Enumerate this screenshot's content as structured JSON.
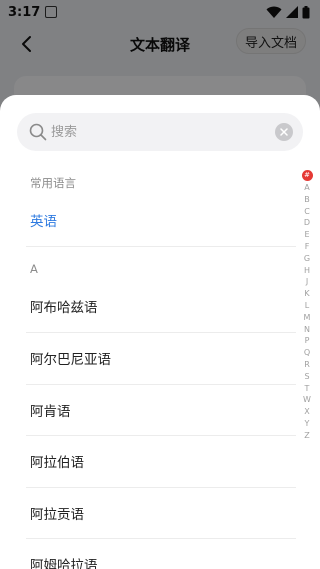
{
  "status_bar": {
    "time": "3:17"
  },
  "header": {
    "title": "文本翻译",
    "import_label": "导入文档"
  },
  "search": {
    "placeholder": "搜索"
  },
  "common": {
    "section_label": "常用语言",
    "items": [
      "英语"
    ]
  },
  "section_a": {
    "label": "A",
    "items": [
      "阿布哈兹语",
      "阿尔巴尼亚语",
      "阿肯语",
      "阿拉伯语",
      "阿拉贡语",
      "阿姆哈拉语"
    ]
  },
  "alpha_index": {
    "hash": "#",
    "letters": [
      "A",
      "B",
      "C",
      "D",
      "E",
      "F",
      "G",
      "H",
      "J",
      "K",
      "L",
      "M",
      "N",
      "P",
      "Q",
      "R",
      "S",
      "T",
      "W",
      "X",
      "Y",
      "Z"
    ]
  },
  "colors": {
    "accent": "#2f7be0",
    "index_active": "#e53935"
  }
}
